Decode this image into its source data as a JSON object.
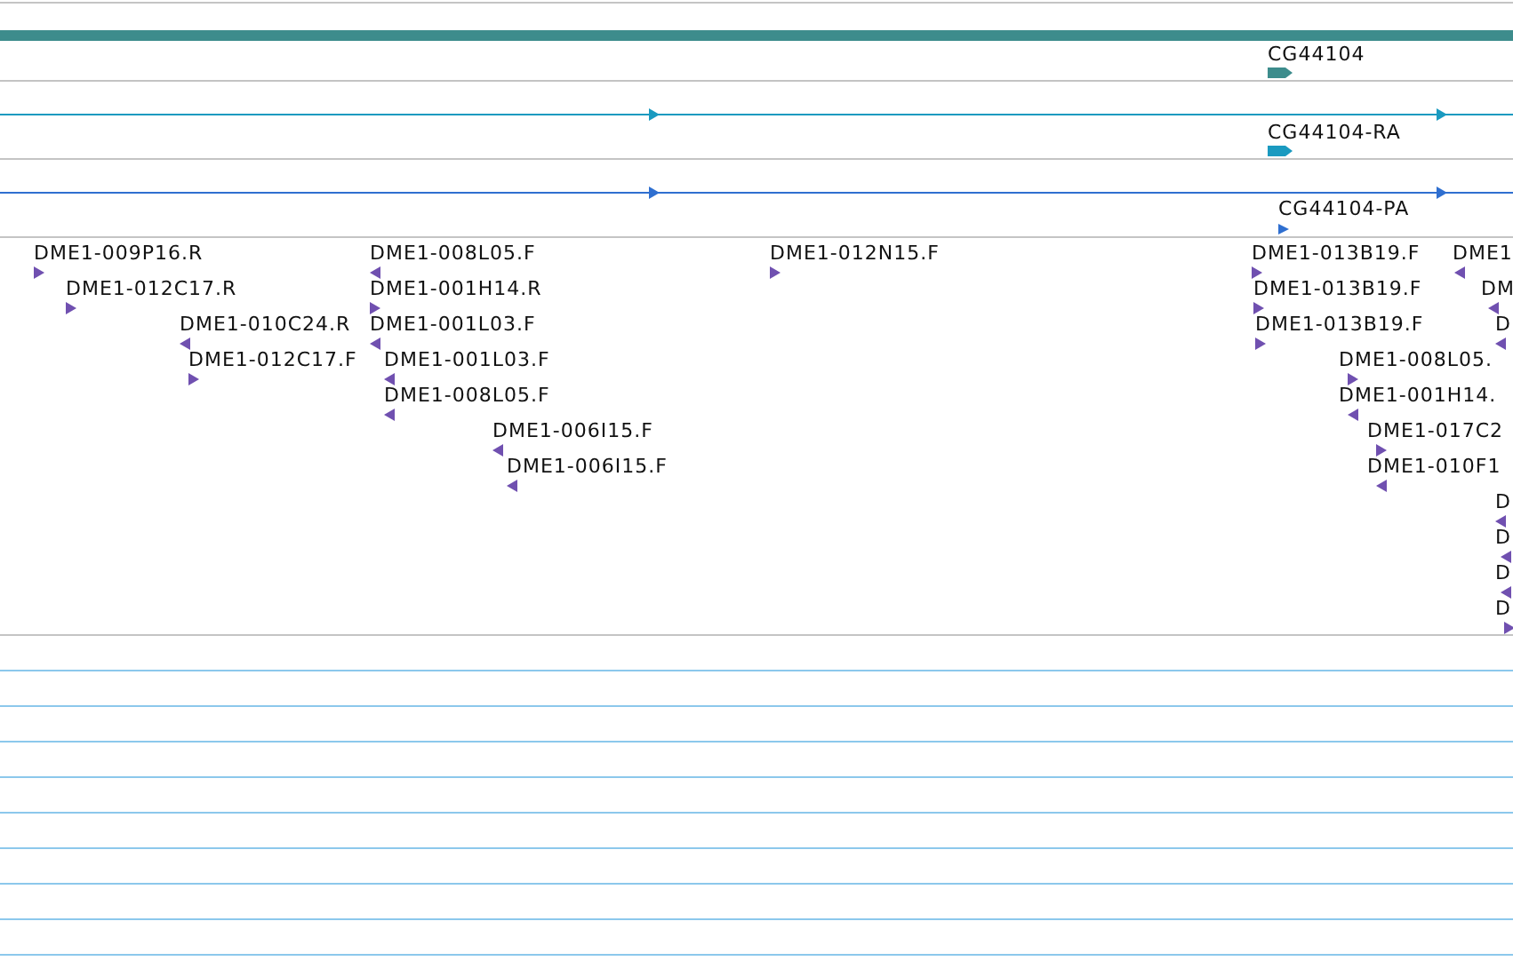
{
  "gene_tracks": [
    {
      "kind": "gene",
      "label": "CG44104"
    },
    {
      "kind": "transcript",
      "label": "CG44104-RA"
    },
    {
      "kind": "protein",
      "label": "CG44104-PA"
    }
  ],
  "clone_features": [
    {
      "label": "DME1-009P16.R",
      "reverse": false
    },
    {
      "label": "DME1-008L05.F",
      "reverse": true
    },
    {
      "label": "DME1-012N15.F",
      "reverse": false
    },
    {
      "label": "DME1-013B19.F",
      "reverse": false
    },
    {
      "label": "DME1",
      "reverse": true
    },
    {
      "label": "DME1-012C17.R",
      "reverse": false
    },
    {
      "label": "DME1-001H14.R",
      "reverse": false
    },
    {
      "label": "DME1-013B19.F",
      "reverse": false
    },
    {
      "label": "DM",
      "reverse": true
    },
    {
      "label": "DME1-010C24.R",
      "reverse": true
    },
    {
      "label": "DME1-001L03.F",
      "reverse": true
    },
    {
      "label": "DME1-013B19.F",
      "reverse": false
    },
    {
      "label": "D",
      "reverse": true
    },
    {
      "label": "DME1-012C17.F",
      "reverse": false
    },
    {
      "label": "DME1-001L03.F",
      "reverse": true
    },
    {
      "label": "DME1-008L05.",
      "reverse": false
    },
    {
      "label": "DME1-008L05.F",
      "reverse": true
    },
    {
      "label": "DME1-001H14.",
      "reverse": true
    },
    {
      "label": "DME1-006I15.F",
      "reverse": true
    },
    {
      "label": "DME1-017C2",
      "reverse": false
    },
    {
      "label": "DME1-006I15.F",
      "reverse": true
    },
    {
      "label": "DME1-010F1",
      "reverse": true
    },
    {
      "label": "D",
      "reverse": true
    },
    {
      "label": "D",
      "reverse": true
    },
    {
      "label": "D",
      "reverse": true
    },
    {
      "label": "D",
      "reverse": false
    }
  ]
}
